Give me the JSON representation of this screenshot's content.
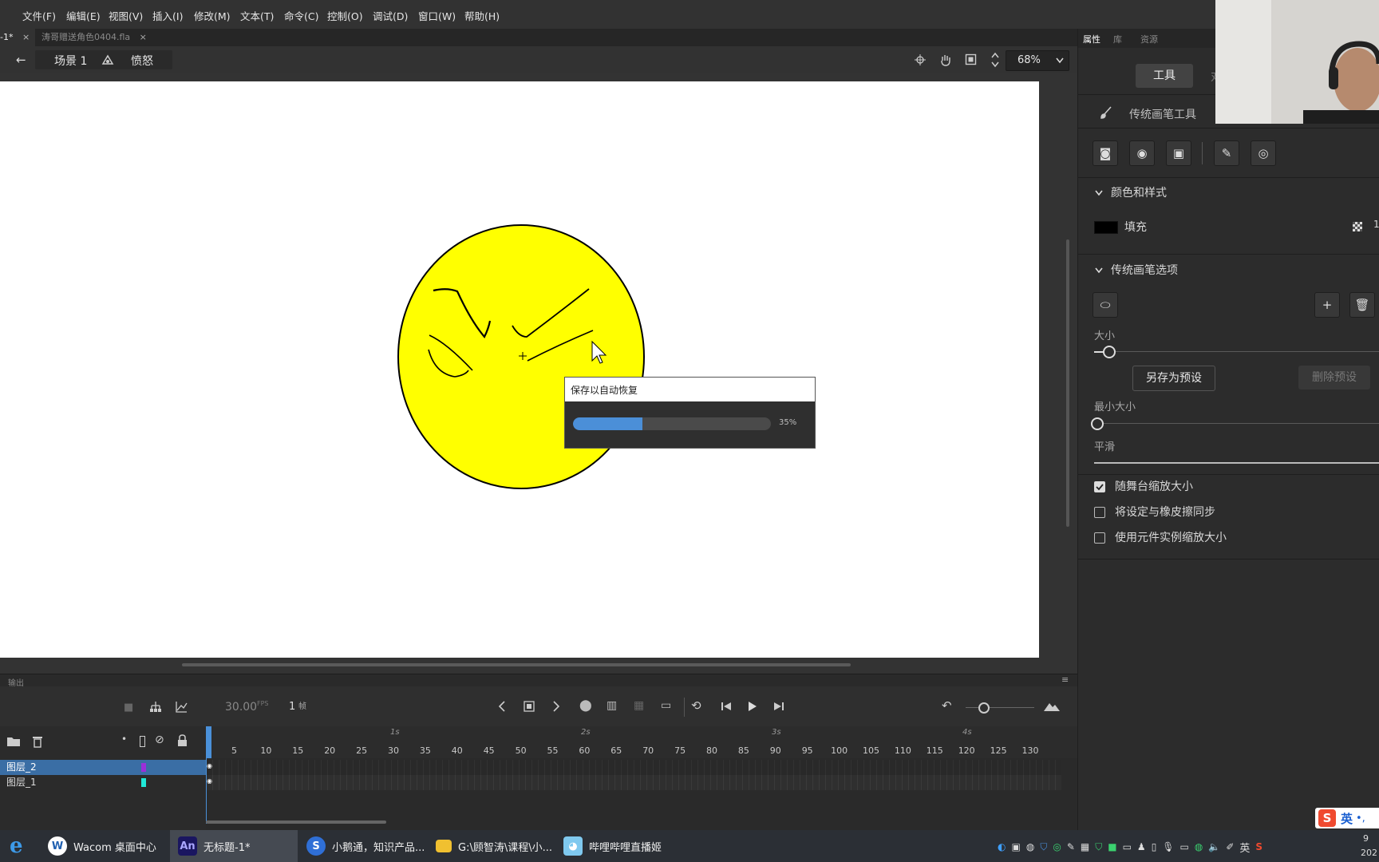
{
  "menu": [
    "文件(F)",
    "编辑(E)",
    "视图(V)",
    "插入(I)",
    "修改(M)",
    "文本(T)",
    "命令(C)",
    "控制(O)",
    "调试(D)",
    "窗口(W)",
    "帮助(H)"
  ],
  "tabs": [
    {
      "label": "-1*",
      "close": "×"
    },
    {
      "label": "涛哥赠送角色0404.fla",
      "close": "×"
    }
  ],
  "editbar": {
    "back": "←",
    "scene": "场景 1",
    "symbol": "愤怒",
    "zoom": "68%"
  },
  "dialog": {
    "title": "保存以自动恢复",
    "percent_label": "35%",
    "progress": 0.35
  },
  "panel": {
    "tabs": [
      "属性",
      "库",
      "资源"
    ],
    "tool_tab": "工具",
    "tool_tab_cut": "对",
    "tool_name": "传统画笔工具",
    "section_color": "颜色和样式",
    "fill_label": "填充",
    "fill_value": "1",
    "section_brush": "传统画笔选项",
    "size_label": "大小",
    "save_preset": "另存为预设",
    "delete_preset": "删除预设",
    "min_size_label": "最小大小",
    "smooth_label": "平滑",
    "checkboxes": [
      {
        "label": "随舞台缩放大小",
        "checked": true
      },
      {
        "label": "将设定与橡皮擦同步",
        "checked": false
      },
      {
        "label": "使用元件实例缩放大小",
        "checked": false
      }
    ]
  },
  "timeline": {
    "output_label": "输出",
    "fps": "30.00",
    "fps_unit": "FPS",
    "frame": "1",
    "frame_unit": "帧",
    "seconds": [
      "1s",
      "2s",
      "3s",
      "4s"
    ],
    "ticks": [
      "5",
      "10",
      "15",
      "20",
      "25",
      "30",
      "35",
      "40",
      "45",
      "50",
      "55",
      "60",
      "65",
      "70",
      "75",
      "80",
      "85",
      "90",
      "95",
      "100",
      "105",
      "110",
      "115",
      "120",
      "125",
      "130"
    ],
    "layers": [
      {
        "name": "图层_2",
        "color": "#9b30d9",
        "selected": true
      },
      {
        "name": "图层_1",
        "color": "#20e8d8",
        "selected": false
      }
    ]
  },
  "taskbar": {
    "items": [
      {
        "label": "Wacom 桌面中心",
        "icon": "wacom-icon"
      },
      {
        "label": "无标题-1*",
        "icon": "animate-icon",
        "badge": "An"
      },
      {
        "label": "小鹅通，知识产品...",
        "icon": "sogou-browser-icon"
      },
      {
        "label": "G:\\顾智涛\\课程\\小...",
        "icon": "folder-icon"
      },
      {
        "label": "哔哩哔哩直播姬",
        "icon": "bilibili-live-icon"
      }
    ],
    "ime": "英",
    "ime_badge": "英",
    "clock_top": "9",
    "clock_bottom": "202"
  }
}
